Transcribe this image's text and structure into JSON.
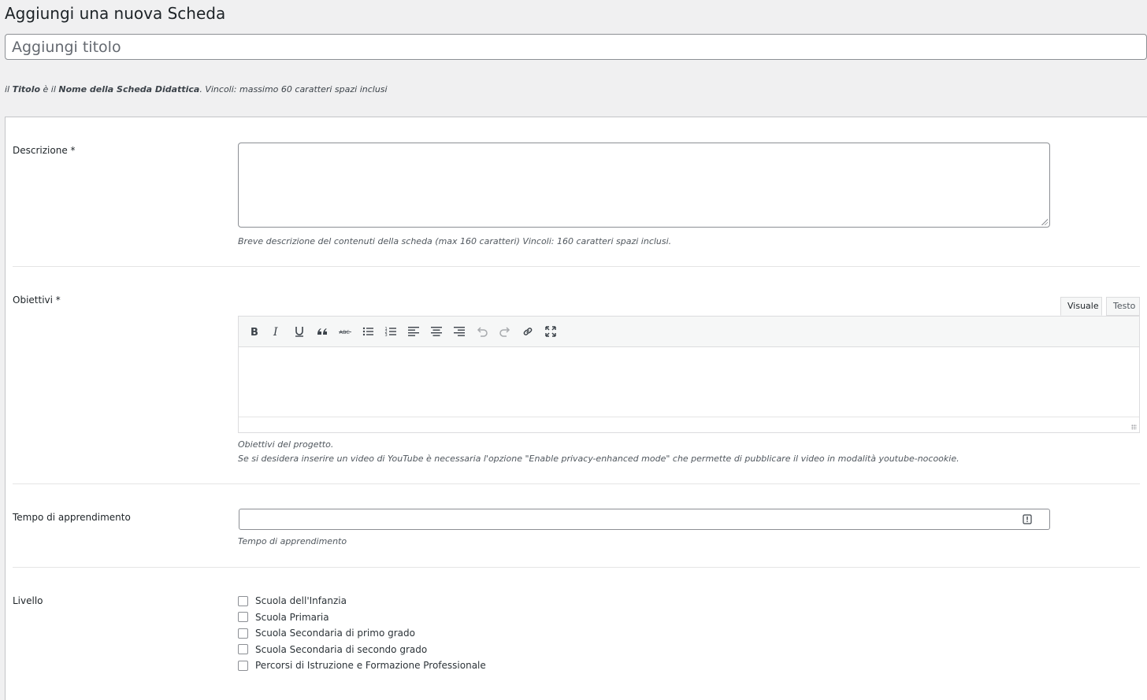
{
  "header": {
    "title": "Aggiungi una nuova Scheda"
  },
  "title_field": {
    "placeholder": "Aggiungi titolo",
    "hint_prefix": "il ",
    "hint_bold1": "Titolo",
    "hint_mid": " è il ",
    "hint_bold2": "Nome della Scheda Didattica",
    "hint_suffix": ". Vincoli: massimo 60 caratteri spazi inclusi"
  },
  "descrizione": {
    "label": "Descrizione",
    "required": "*",
    "hint": "Breve descrizione del contenuti della scheda (max 160 caratteri) Vincoli: 160 caratteri spazi inclusi."
  },
  "obiettivi": {
    "label": "Obiettivi",
    "required": "*",
    "tabs": [
      "Visuale",
      "Testo"
    ],
    "toolbar_icons": [
      "bold-icon",
      "italic-icon",
      "underline-icon",
      "blockquote-icon",
      "strikethrough-icon",
      "bullet-list-icon",
      "numbered-list-icon",
      "align-left-icon",
      "align-center-icon",
      "align-right-icon",
      "undo-icon",
      "redo-icon",
      "link-icon",
      "fullscreen-icon"
    ],
    "hint_line1": "Obiettivi del progetto.",
    "hint_line2": "Se si desidera inserire un video di YouTube è necessaria l'opzione \"Enable privacy-enhanced mode\" che permette di pubblicare il video in modalità youtube-nocookie."
  },
  "tempo": {
    "label": "Tempo di apprendimento",
    "hint": "Tempo di apprendimento"
  },
  "livello": {
    "label": "Livello",
    "options": [
      "Scuola dell'Infanzia",
      "Scuola Primaria",
      "Scuola Secondaria di primo grado",
      "Scuola Secondaria di secondo grado",
      "Percorsi di Istruzione e Formazione Professionale"
    ]
  }
}
